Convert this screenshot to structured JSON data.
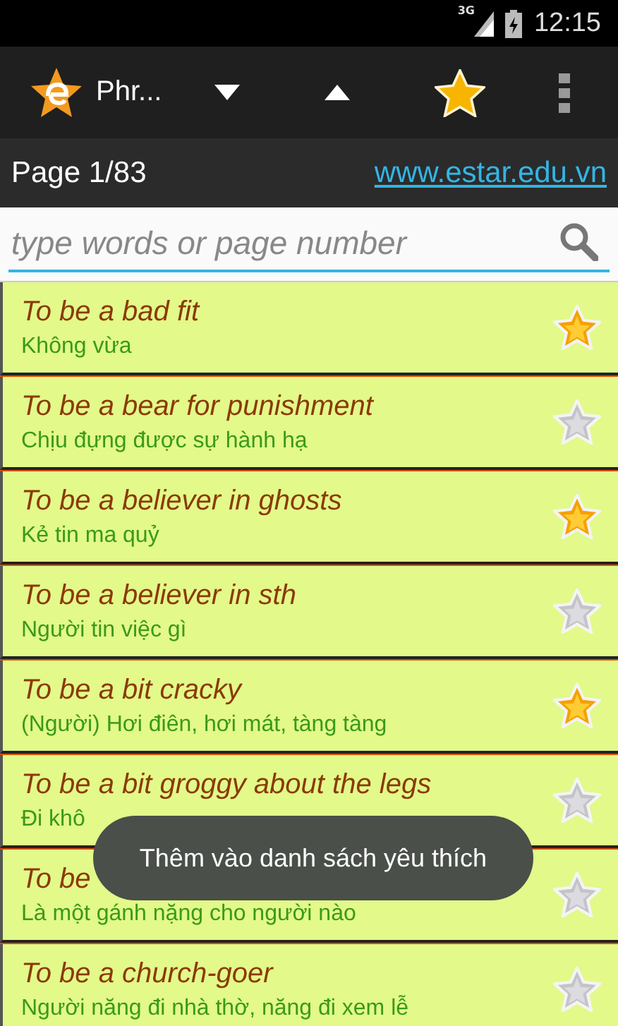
{
  "status_bar": {
    "network": "3G",
    "time": "12:15"
  },
  "action_bar": {
    "title": "Phr..."
  },
  "info_bar": {
    "page": "Page 1/83",
    "link": "www.estar.edu.vn"
  },
  "search": {
    "placeholder": "type words or page number"
  },
  "phrases": [
    {
      "phrase": "To be a bad fit",
      "meaning": "Không vừa",
      "favorite": true
    },
    {
      "phrase": "To be a bear for punishment",
      "meaning": "Chịu đựng được sự hành hạ",
      "favorite": false
    },
    {
      "phrase": "To be a believer in ghosts",
      "meaning": "Kẻ tin ma quỷ",
      "favorite": true
    },
    {
      "phrase": "To be a believer in sth",
      "meaning": "Người tin việc gì",
      "favorite": false
    },
    {
      "phrase": "To be a bit cracky",
      "meaning": "(Người) Hơi điên, hơi mát, tàng tàng",
      "favorite": true
    },
    {
      "phrase": "To be a bit groggy about the legs",
      "meaning": "Đi khô",
      "favorite": false
    },
    {
      "phrase": "To be",
      "meaning": "Là một gánh nặng cho người nào",
      "favorite": false
    },
    {
      "phrase": "To be a church-goer",
      "meaning": "Người năng đi nhà thờ, năng đi xem lễ",
      "favorite": false
    }
  ],
  "toast": {
    "text": "Thêm vào danh sách yêu thích"
  }
}
